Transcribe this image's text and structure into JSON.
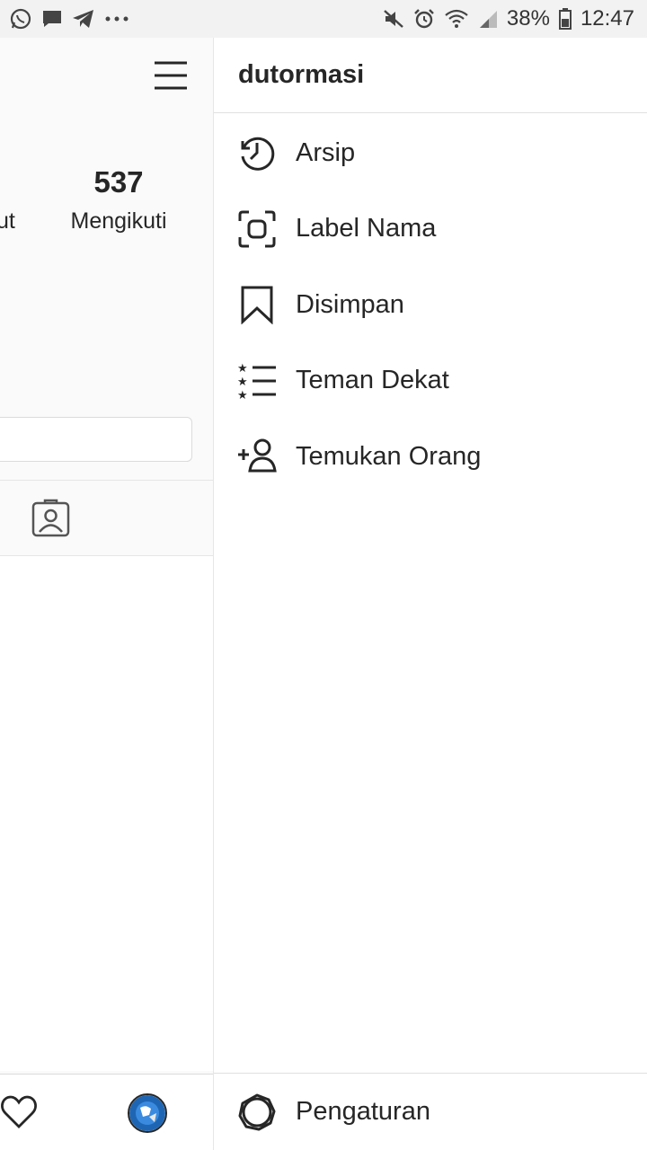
{
  "status_bar": {
    "left_icons": [
      "whatsapp-icon",
      "message-icon",
      "telegram-icon",
      "more-dots-icon"
    ],
    "battery": "38%",
    "time": "12:47"
  },
  "profile": {
    "following_count": "537",
    "following_label": "Mengikuti",
    "followers_label_partial": "ut"
  },
  "drawer": {
    "username": "dutormasi",
    "items": [
      {
        "label": "Arsip",
        "icon": "archive-clock-icon"
      },
      {
        "label": "Label Nama",
        "icon": "nametag-icon"
      },
      {
        "label": "Disimpan",
        "icon": "bookmark-icon"
      },
      {
        "label": "Teman Dekat",
        "icon": "close-friends-list-icon"
      },
      {
        "label": "Temukan Orang",
        "icon": "add-person-icon"
      }
    ],
    "footer_label": "Pengaturan"
  },
  "colors": {
    "text": "#262626",
    "divider": "#e0e0e0",
    "panel_bg": "#fafafa",
    "status_bar_bg": "#f2f2f2"
  }
}
